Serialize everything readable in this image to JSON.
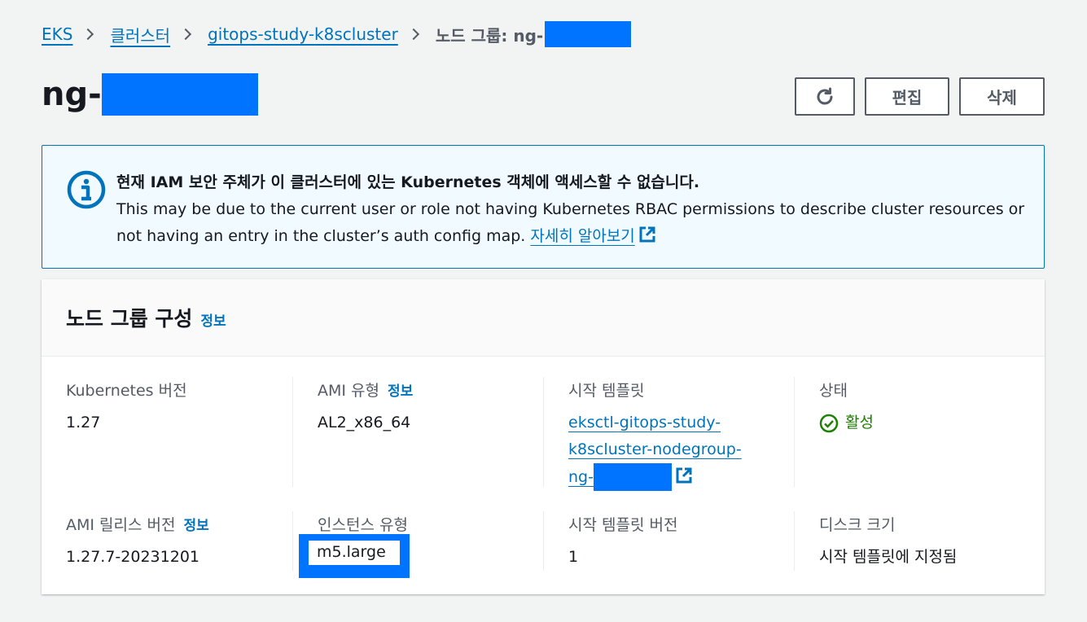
{
  "breadcrumb": {
    "items": [
      "EKS",
      "클러스터",
      "gitops-study-k8scluster"
    ],
    "current": "노드 그룹: ng-"
  },
  "page": {
    "title": "ng-"
  },
  "actions": {
    "refresh_icon": "refresh-icon",
    "edit_label": "편집",
    "delete_label": "삭제"
  },
  "alert": {
    "icon": "info-icon",
    "title": "현재 IAM 보안 주체가 이 클러스터에 있는 Kubernetes 객체에 액세스할 수 없습니다.",
    "body": "This may be due to the current user or role not having Kubernetes RBAC permissions to describe cluster resources or not having an entry in the cluster’s auth config map.",
    "link": "자세히 알아보기"
  },
  "config": {
    "title": "노드 그룹 구성",
    "info": "정보",
    "fields": {
      "k8s_version": {
        "label": "Kubernetes 버전",
        "value": "1.27"
      },
      "ami_type": {
        "label": "AMI 유형",
        "info": "정보",
        "value": "AL2_x86_64"
      },
      "launch_template": {
        "label": "시작 템플릿",
        "value_line1": "eksctl-gitops-study-",
        "value_line2": "k8scluster-nodegroup-",
        "value_line3": "ng-"
      },
      "status": {
        "label": "상태",
        "value": "활성",
        "color": "#1d8102"
      },
      "ami_release": {
        "label": "AMI 릴리스 버전",
        "info": "정보",
        "value": "1.27.7-20231201"
      },
      "instance_type": {
        "label": "인스턴스 유형",
        "value": "m5.large"
      },
      "launch_template_version": {
        "label": "시작 템플릿 버전",
        "value": "1"
      },
      "disk_size": {
        "label": "디스크 크기",
        "value": "시작 템플릿에 지정됨"
      }
    }
  },
  "colors": {
    "link": "#0073bb",
    "redaction": "#0073ff",
    "success": "#1d8102"
  }
}
